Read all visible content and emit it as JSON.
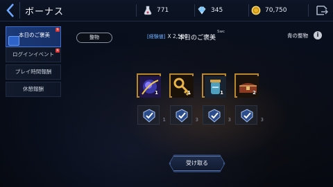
{
  "header": {
    "title": "ボーナス",
    "resources": [
      {
        "icon": "flask-icon",
        "value": "771"
      },
      {
        "icon": "crystal-icon",
        "value": "345"
      },
      {
        "icon": "gold-coin-icon",
        "value": "70,750"
      }
    ]
  },
  "sidebar": {
    "items": [
      {
        "label": "本日のご褒美",
        "active": true,
        "badge": "N"
      },
      {
        "label": "ログインイベント",
        "active": false,
        "badge": "N"
      },
      {
        "label": "プレイ時間報酬",
        "active": false
      },
      {
        "label": "休憩報酬",
        "active": false
      }
    ]
  },
  "main": {
    "archive_label": "整物",
    "bonus_label": "[経験値]",
    "multiplier": "X 2,500",
    "title": "本日のご褒美",
    "swc": "Swc",
    "blue_gift_label": "青の整物",
    "info_icon": "i",
    "rewards": [
      {
        "icon": "magic-orb-icon",
        "qty": "1",
        "count": "1"
      },
      {
        "icon": "golden-key-icon",
        "qty": "1",
        "count": "3"
      },
      {
        "icon": "potion-jar-icon",
        "qty": "1",
        "count": "3"
      },
      {
        "icon": "treasure-chest-icon",
        "qty": "2",
        "count": "3"
      }
    ],
    "receive_label": "受け取る"
  },
  "colors": {
    "accent_blue": "#3f6fd0",
    "card_border": "#b8892e",
    "badge_red": "#d43434"
  }
}
